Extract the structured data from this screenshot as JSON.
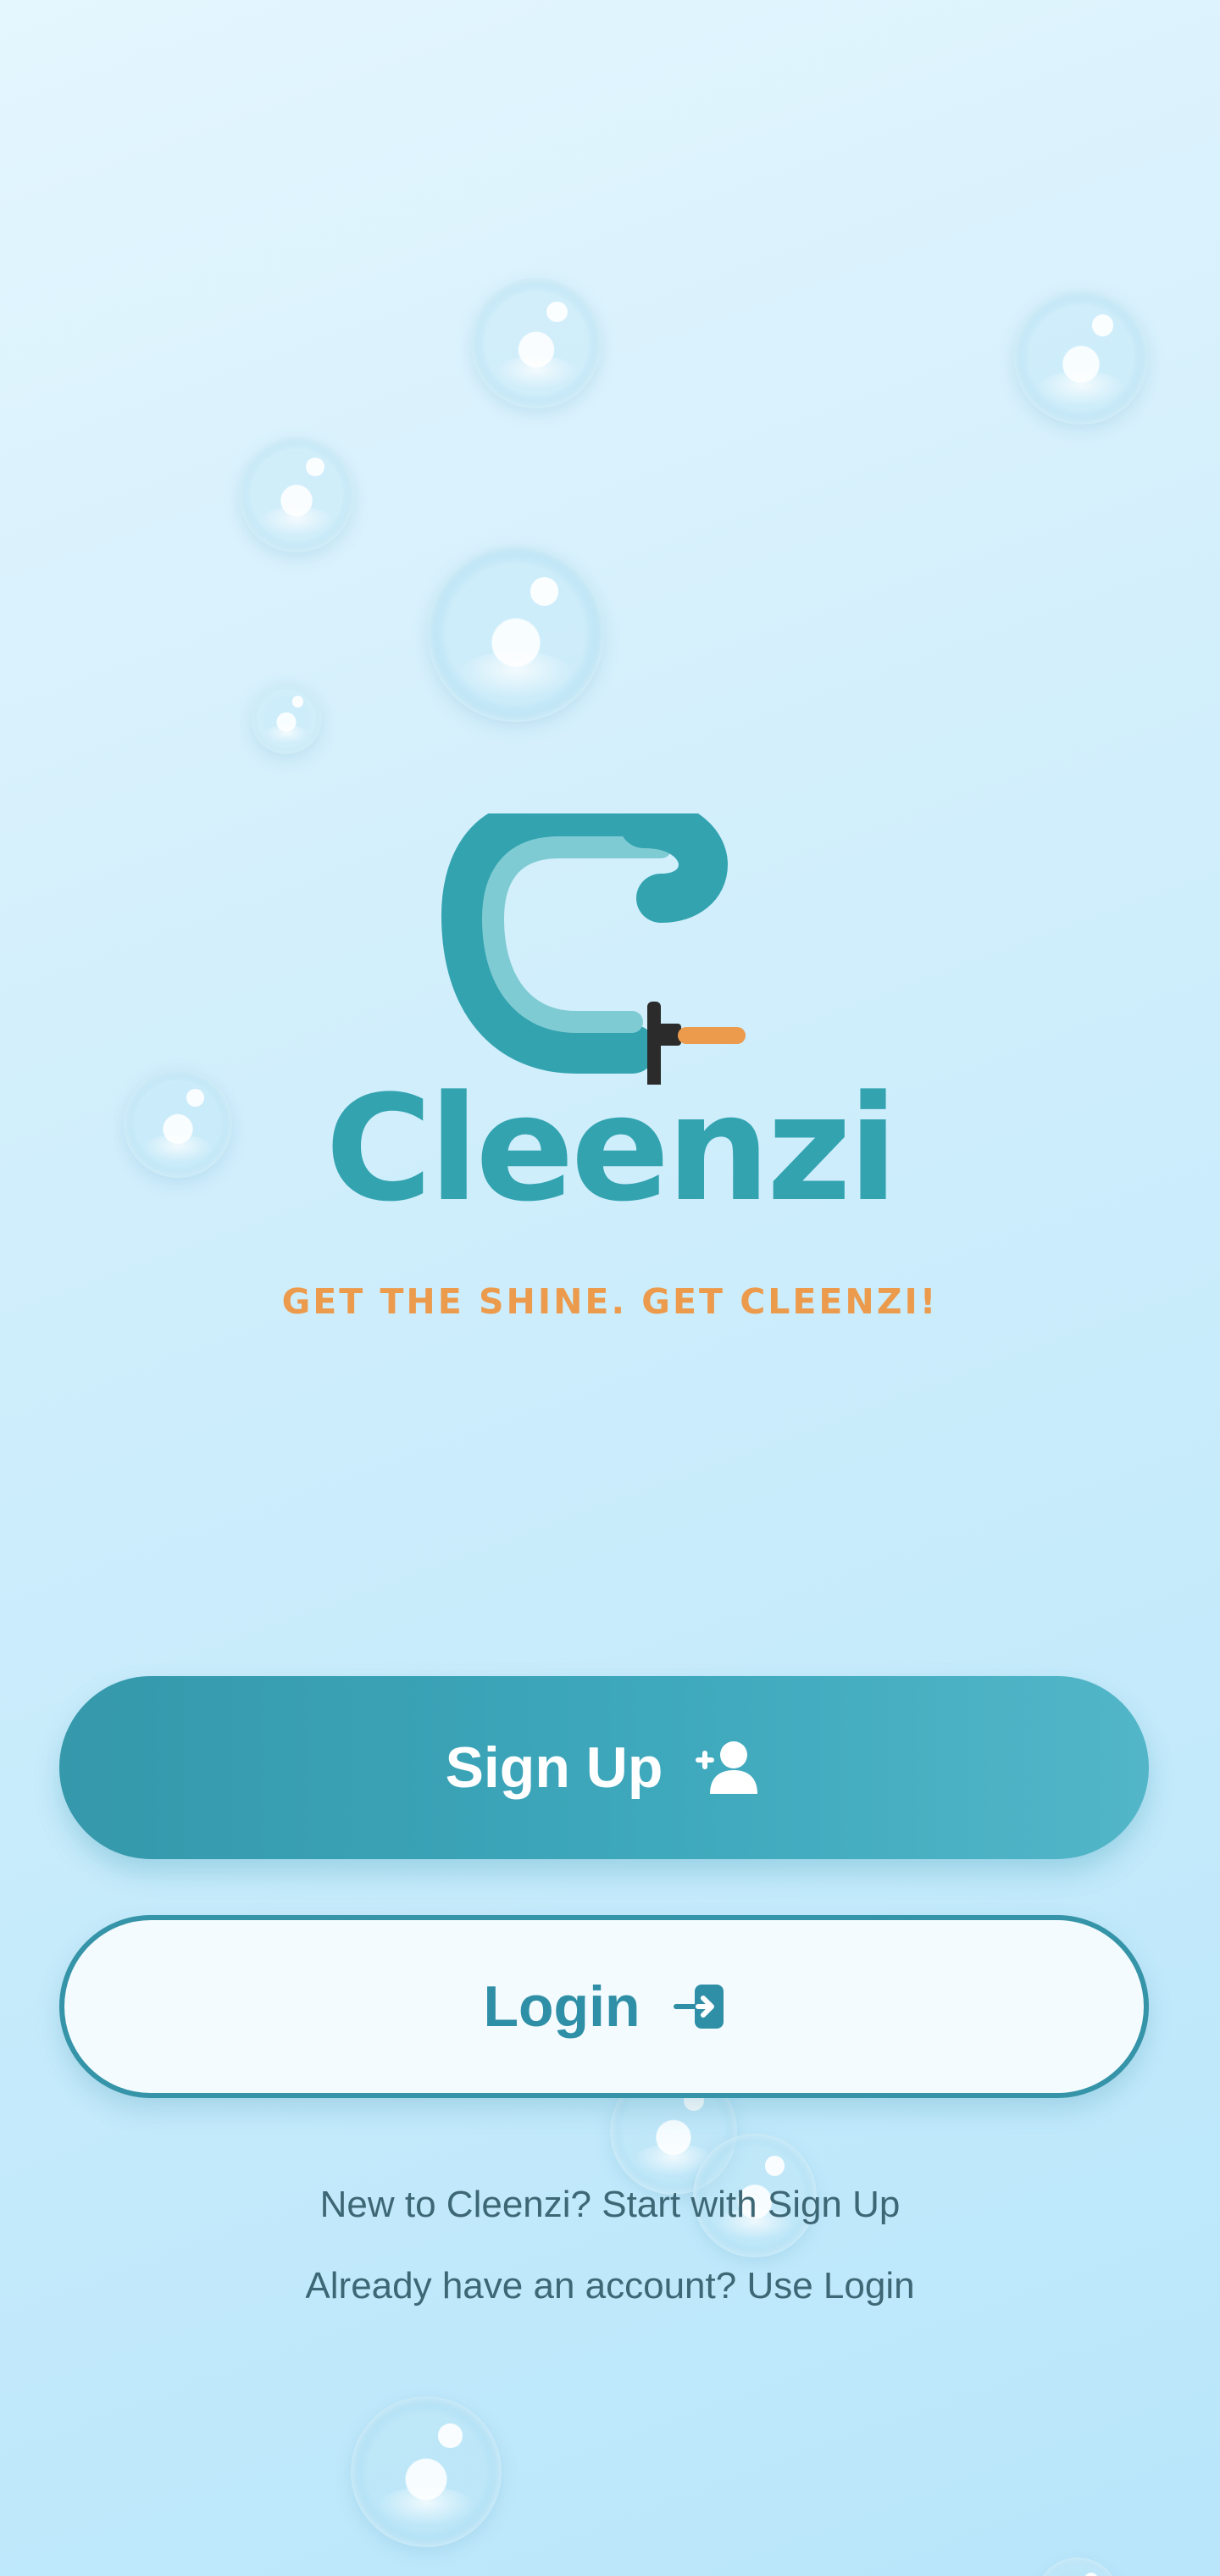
{
  "brand": {
    "name": "Cleenzi",
    "tagline": "GET THE SHINE. GET CLEENZI!",
    "primary_color": "#33a3b0",
    "accent_color": "#ec9a4c",
    "logo_icon": "letter-c-squeegee-icon"
  },
  "actions": {
    "signup_label": "Sign Up",
    "signup_icon": "add-user-icon",
    "login_label": "Login",
    "login_icon": "login-arrow-icon"
  },
  "hints": {
    "new_user": "New to Cleenzi? Start with Sign Up",
    "existing_user": "Already have an account? Use Login"
  },
  "decor": {
    "background_icon": "soap-bubble-icon"
  }
}
